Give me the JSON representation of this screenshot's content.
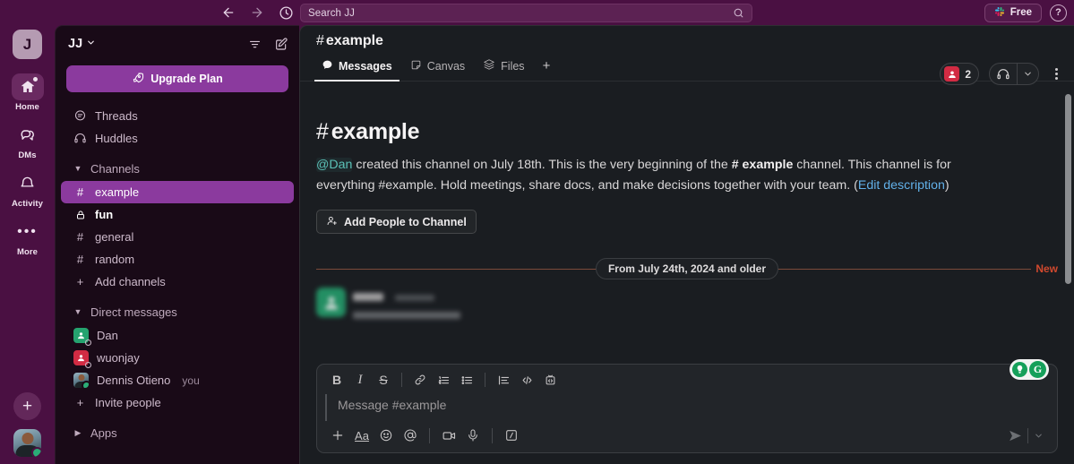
{
  "topbar": {
    "back_icon": "arrow-left-icon",
    "forward_icon": "arrow-right-icon",
    "history_icon": "clock-icon",
    "search_placeholder": "Search JJ",
    "search_icon": "search-icon",
    "plan_label": "Free",
    "plan_icon": "slack-logo-icon",
    "help_label": "?"
  },
  "rail": {
    "workspace_initial": "J",
    "items": [
      {
        "label": "Home",
        "icon": "home-icon",
        "active": true,
        "badge": true
      },
      {
        "label": "DMs",
        "icon": "dm-bubble-icon",
        "active": false,
        "badge": false
      },
      {
        "label": "Activity",
        "icon": "bell-icon",
        "active": false,
        "badge": false
      },
      {
        "label": "More",
        "icon": "ellipsis-icon",
        "active": false,
        "badge": false
      }
    ],
    "new_label": "+",
    "avatar_name": "user-avatar"
  },
  "sidebar": {
    "workspace_name": "JJ",
    "filter_icon": "filter-icon",
    "compose_icon": "compose-icon",
    "upgrade_label": "Upgrade Plan",
    "upgrade_icon": "rocket-icon",
    "shortcuts": [
      {
        "label": "Threads",
        "icon": "threads-icon"
      },
      {
        "label": "Huddles",
        "icon": "headphones-icon"
      }
    ],
    "channels_section": "Channels",
    "channels": [
      {
        "label": "example",
        "icon": "hash-icon",
        "selected": true,
        "unread": false
      },
      {
        "label": "fun",
        "icon": "lock-icon",
        "selected": false,
        "unread": true
      },
      {
        "label": "general",
        "icon": "hash-icon",
        "selected": false,
        "unread": false
      },
      {
        "label": "random",
        "icon": "hash-icon",
        "selected": false,
        "unread": false
      }
    ],
    "add_channels_label": "Add channels",
    "dm_section": "Direct messages",
    "dms": [
      {
        "label": "Dan",
        "avatar": "green",
        "presence": "away",
        "suffix": ""
      },
      {
        "label": "wuonjay",
        "avatar": "red",
        "presence": "away",
        "suffix": ""
      },
      {
        "label": "Dennis Otieno",
        "avatar": "photo",
        "presence": "online",
        "suffix": "you"
      }
    ],
    "invite_label": "Invite people",
    "apps_section": "Apps"
  },
  "channel": {
    "name": "example",
    "hash": "#",
    "member_count": "2",
    "huddle_icon": "headphones-icon",
    "kebab_icon": "more-vertical-icon",
    "tabs": [
      {
        "label": "Messages",
        "icon": "chat-bubble-icon",
        "active": true
      },
      {
        "label": "Canvas",
        "icon": "canvas-icon",
        "active": false
      },
      {
        "label": "Files",
        "icon": "files-icon",
        "active": false
      },
      {
        "label": "+",
        "icon": "plus-icon",
        "active": false
      }
    ]
  },
  "intro": {
    "title_hash": "#",
    "title": "example",
    "creator": "@Dan",
    "text_1": " created this channel on July 18th. This is the very beginning of the ",
    "channel_ref_hash": "#",
    "channel_ref": "example",
    "text_2": " channel. This channel is for everything #example. Hold meetings, share docs, and make decisions together with your team. (",
    "edit_link": "Edit description",
    "text_3": ")",
    "add_people_label": "Add People to Channel",
    "add_people_icon": "person-plus-icon"
  },
  "divider": {
    "pill_label": "From July 24th, 2024 and older",
    "new_label": "New"
  },
  "composer": {
    "placeholder": "Message #example",
    "format_buttons": [
      {
        "name": "bold-button",
        "glyph": "B"
      },
      {
        "name": "italic-button",
        "glyph": "I"
      },
      {
        "name": "strikethrough-button",
        "glyph": "S"
      },
      {
        "name": "link-button",
        "glyph": "link-icon"
      },
      {
        "name": "ordered-list-button",
        "glyph": "ordered-list-icon"
      },
      {
        "name": "bullet-list-button",
        "glyph": "bullet-list-icon"
      },
      {
        "name": "blockquote-button",
        "glyph": "blockquote-icon"
      },
      {
        "name": "code-button",
        "glyph": "code-icon"
      },
      {
        "name": "code-block-button",
        "glyph": "code-block-icon"
      }
    ],
    "action_buttons": [
      {
        "name": "attach-button",
        "glyph": "plus-icon"
      },
      {
        "name": "formatting-button",
        "glyph": "Aa"
      },
      {
        "name": "emoji-button",
        "glyph": "smiley-icon"
      },
      {
        "name": "mention-button",
        "glyph": "at-icon"
      },
      {
        "name": "video-clip-button",
        "glyph": "video-icon"
      },
      {
        "name": "audio-clip-button",
        "glyph": "mic-icon"
      },
      {
        "name": "slash-command-button",
        "glyph": "slash-icon"
      }
    ],
    "send_icon": "send-icon",
    "send_options_icon": "chevron-down-icon",
    "grammarly_g": "G"
  }
}
